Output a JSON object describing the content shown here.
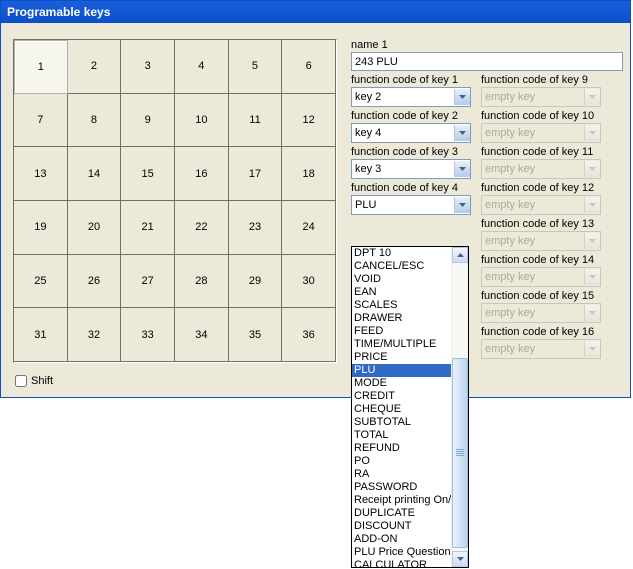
{
  "window": {
    "title": "Programable keys"
  },
  "keygrid": {
    "numbers": [
      "1",
      "2",
      "3",
      "4",
      "5",
      "6",
      "7",
      "8",
      "9",
      "10",
      "11",
      "12",
      "13",
      "14",
      "15",
      "16",
      "17",
      "18",
      "19",
      "20",
      "21",
      "22",
      "23",
      "24",
      "25",
      "26",
      "27",
      "28",
      "29",
      "30",
      "31",
      "32",
      "33",
      "34",
      "35",
      "36"
    ],
    "selected_index": 0
  },
  "shift": {
    "label": "Shift",
    "checked": false
  },
  "name_field": {
    "label": "name 1",
    "value": "243 PLU"
  },
  "left_keys": [
    {
      "label": "function code of key 1",
      "value": "key 2",
      "disabled": false
    },
    {
      "label": "function code of key 2",
      "value": "key 4",
      "disabled": false
    },
    {
      "label": "function code of key 3",
      "value": "key 3",
      "disabled": false
    },
    {
      "label": "function code of key 4",
      "value": "PLU",
      "disabled": false,
      "open": true
    },
    {
      "label": "",
      "value": "",
      "hidden": true
    },
    {
      "label": "",
      "value": "",
      "hidden": true
    },
    {
      "label": "",
      "value": "",
      "hidden": true
    },
    {
      "label": "",
      "value": "",
      "hidden": true
    }
  ],
  "right_keys": [
    {
      "label": "function code of key 9",
      "value": "empty key",
      "disabled": true
    },
    {
      "label": "function code of key 10",
      "value": "empty key",
      "disabled": true
    },
    {
      "label": "function code of key 11",
      "value": "empty key",
      "disabled": true
    },
    {
      "label": "function code of key 12",
      "value": "empty key",
      "disabled": true
    },
    {
      "label": "function code of key 13",
      "value": "empty key",
      "disabled": true
    },
    {
      "label": "function code of key 14",
      "value": "empty key",
      "disabled": true
    },
    {
      "label": "function code of key 15",
      "value": "empty key",
      "disabled": true
    },
    {
      "label": "function code of key 16",
      "value": "empty key",
      "disabled": true
    }
  ],
  "dropdown": {
    "items": [
      "DPT 10",
      "CANCEL/ESC",
      "VOID",
      "EAN",
      "SCALES",
      "DRAWER",
      "FEED",
      "TIME/MULTIPLE",
      "PRICE",
      "PLU",
      "MODE",
      "CREDIT",
      "CHEQUE",
      "SUBTOTAL",
      "TOTAL",
      "REFUND",
      "PO",
      "RA",
      "PASSWORD",
      "Receipt printing On/Off",
      "DUPLICATE",
      "DISCOUNT",
      "ADD-ON",
      "PLU Price Question",
      "CALCULATOR"
    ],
    "selected_index": 9
  }
}
